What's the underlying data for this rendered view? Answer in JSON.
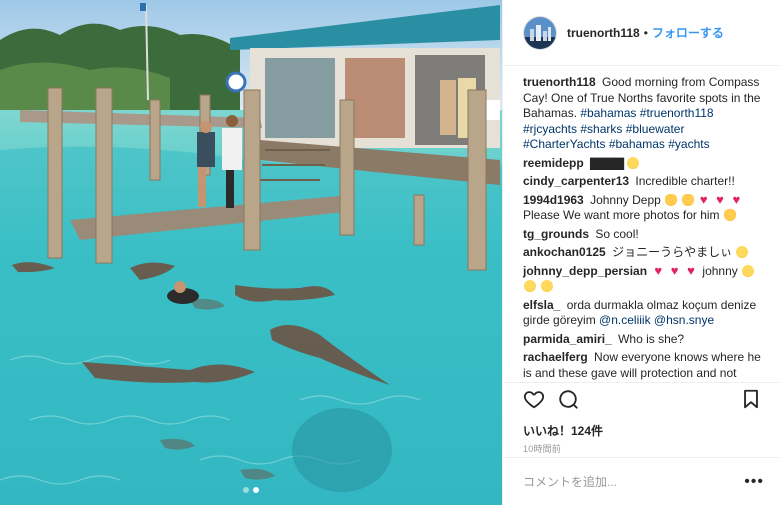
{
  "header": {
    "username": "truenorth118",
    "separator": "•",
    "follow_label": "フォローする"
  },
  "caption": {
    "username": "truenorth118",
    "text": "Good morning from Compass Cay! One of True Norths favorite spots in the Bahamas.",
    "tags_line1": [
      "#bahamas",
      "#truenorth118"
    ],
    "tags_line2": [
      "#rjcyachts",
      "#sharks",
      "#bluewater"
    ],
    "tags_line3": [
      "#CharterYachts",
      "#bahamas",
      "#yachts"
    ]
  },
  "comments": [
    {
      "user": "reemidepp",
      "text": "▇▇▇▇"
    },
    {
      "user": "cindy_carpenter13",
      "text": "Incredible charter!!"
    },
    {
      "user": "1994d1963",
      "text": "Johnny Depp",
      "text2": "Please We want more photos for him"
    },
    {
      "user": "tg_grounds",
      "text": "So cool!"
    },
    {
      "user": "ankochan0125",
      "text": "ジョニーうらやましぃ"
    },
    {
      "user": "johnny_depp_persian",
      "text": "johnny"
    },
    {
      "user": "elfsla_",
      "text": "orda durmakla olmaz koçum denize girde göreyim",
      "mention1": "@n.celiiik",
      "mention2": "@hsn.snye"
    },
    {
      "user": "parmida_amiri_",
      "text": "Who is she?"
    },
    {
      "user": "rachaelferg",
      "text": "Now everyone knows where he is and these gave will protection and not"
    }
  ],
  "likes": "いいね！124件",
  "time": "10時間前",
  "add_comment_placeholder": "コメントを追加...",
  "more_label": "•••",
  "colors": {
    "accent": "#3897f0",
    "hashtag": "#003569",
    "water": "#43c1c7",
    "border": "#efefef"
  },
  "icons": [
    "heart-icon",
    "comment-icon",
    "bookmark-icon",
    "more-options-icon"
  ]
}
